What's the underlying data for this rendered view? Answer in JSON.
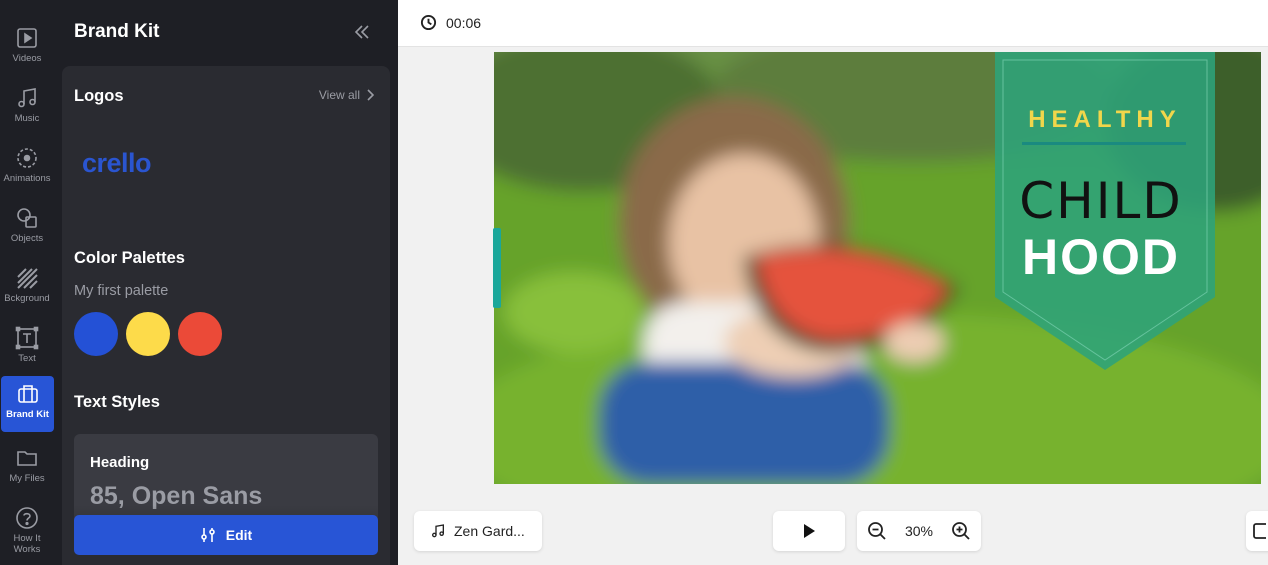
{
  "rail": [
    {
      "label": "Videos",
      "icon": "play-square-icon"
    },
    {
      "label": "Music",
      "icon": "music-note-icon"
    },
    {
      "label": "Animations",
      "icon": "animation-icon"
    },
    {
      "label": "Objects",
      "icon": "shapes-icon"
    },
    {
      "label": "Bckground",
      "icon": "stripes-icon"
    },
    {
      "label": "Text",
      "icon": "text-icon"
    },
    {
      "label": "Brand Kit",
      "icon": "briefcase-icon",
      "active": true
    },
    {
      "label": "My Files",
      "icon": "folder-icon"
    },
    {
      "label": "How It Works",
      "icon": "help-icon"
    }
  ],
  "panel": {
    "title": "Brand Kit",
    "logos": {
      "title": "Logos",
      "view_all": "View all",
      "logo_text": "crello"
    },
    "palettes": {
      "title": "Color Palettes",
      "palette_name": "My first palette",
      "colors": [
        "#2451d6",
        "#fddb4a",
        "#eb4a38"
      ]
    },
    "text_styles": {
      "title": "Text Styles",
      "label": "Heading",
      "value": "85, Open Sans"
    },
    "edit_label": "Edit"
  },
  "topbar": {
    "time": "00:06"
  },
  "canvas": {
    "headline_top": "HEALTHY",
    "headline_mid": "CHILD",
    "headline_bottom": "HOOD",
    "accent_color": "#f1d64b",
    "banner_color": "#2ea37a"
  },
  "bottom": {
    "music_label": "Zen Gard...",
    "zoom": "30%"
  }
}
